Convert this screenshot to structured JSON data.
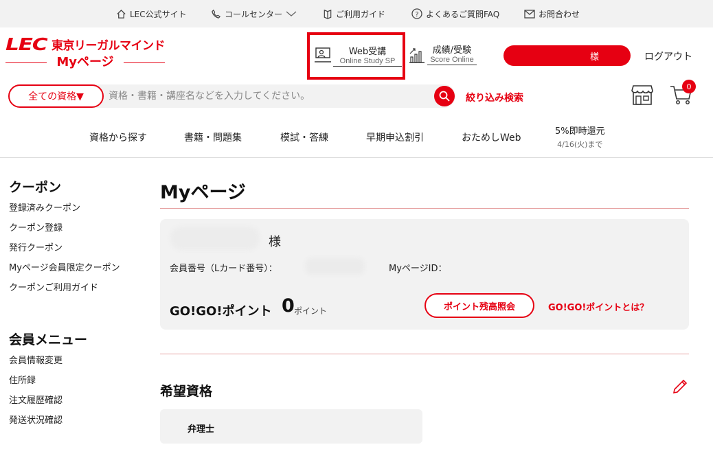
{
  "topbar": {
    "items": [
      {
        "label": "LEC公式サイト",
        "icon": "home-icon"
      },
      {
        "label": "コールセンター",
        "icon": "phone-icon"
      },
      {
        "label": "ご利用ガイド",
        "icon": "guide-icon"
      },
      {
        "label": "よくあるご質問FAQ",
        "icon": "question-icon"
      },
      {
        "label": "お問合わせ",
        "icon": "mail-icon"
      }
    ]
  },
  "logo": {
    "brand": "LEC",
    "name": "東京リーガルマインド",
    "sub": "Myページ"
  },
  "header": {
    "web": {
      "title": "Web受講",
      "subtitle": "Online Study SP"
    },
    "score": {
      "title": "成績/受験",
      "subtitle": "Score Online"
    },
    "user_suffix": "様",
    "logout": "ログアウト"
  },
  "search": {
    "category": "全ての資格▼",
    "placeholder": "資格・書籍・講座名などを入力してください。",
    "refine": "絞り込み検索"
  },
  "cart": {
    "count": "0"
  },
  "nav": {
    "items": [
      "資格から探す",
      "書籍・問題集",
      "模試・答練",
      "早期申込割引",
      "おためしWeb"
    ],
    "promo_title": "5%即時還元",
    "promo_date": "4/16(火)まで"
  },
  "sidebar": {
    "coupon_heading": "クーポン",
    "coupon_links": [
      "登録済みクーポン",
      "クーポン登録",
      "発行クーポン",
      "Myページ会員限定クーポン",
      "クーポンご利用ガイド"
    ],
    "member_heading": "会員メニュー",
    "member_links": [
      "会員情報変更",
      "住所録",
      "注文履歴確認",
      "発送状況確認"
    ]
  },
  "main": {
    "title": "Myページ",
    "name_suffix": "様",
    "member_no_label": "会員番号（Lカード番号）：",
    "mypage_id_label": "MyページID：",
    "points_label": "GO!GO!ポイント",
    "points_value": "0",
    "points_unit": "ポイント",
    "points_button": "ポイント残高照会",
    "points_link": "GO!GO!ポイントとは？",
    "wish_heading": "希望資格",
    "wish_items": [
      "弁理士"
    ]
  },
  "colors": {
    "accent": "#e60012",
    "panel": "#f2f2f2"
  }
}
